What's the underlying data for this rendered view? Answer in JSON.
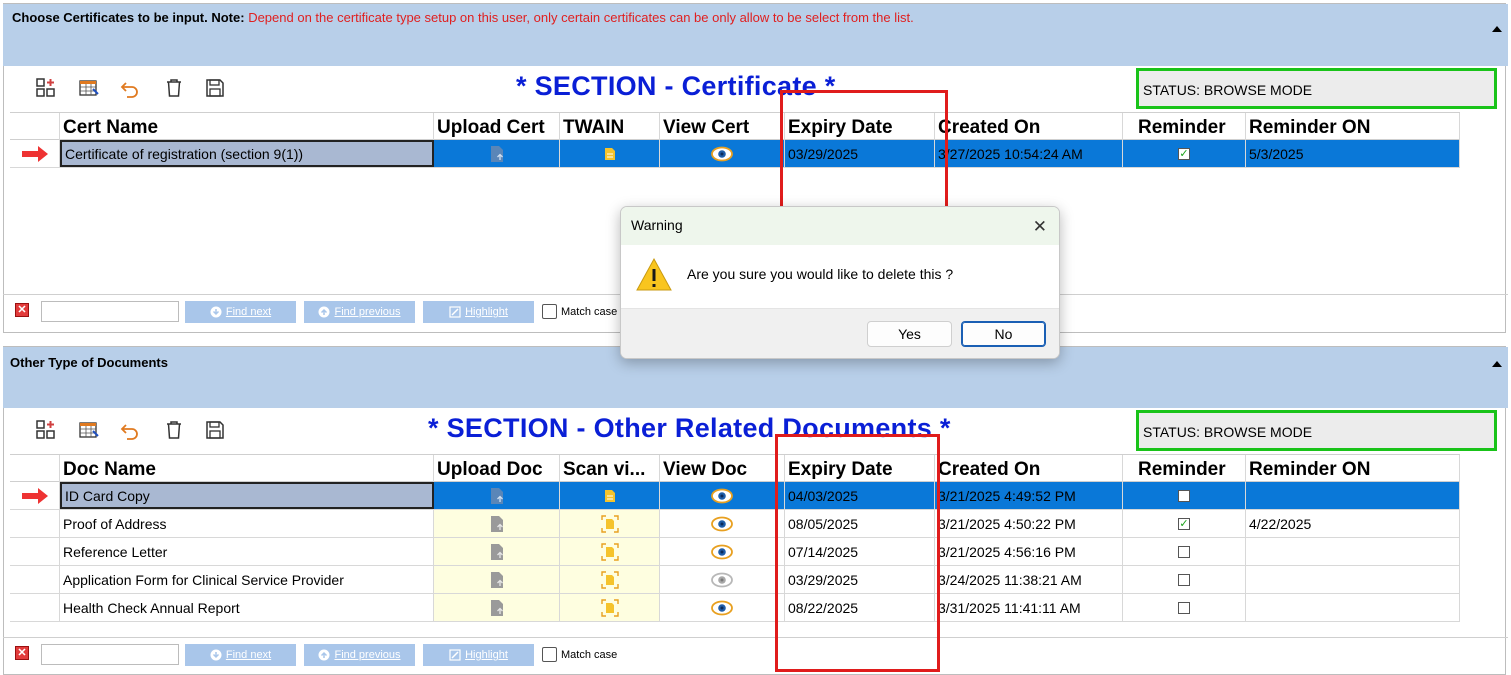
{
  "colors": {
    "header_bg": "#b8cfe9",
    "section_title": "#0a1fd6",
    "status_border": "#19c319",
    "selected_row": "#0a78d8",
    "highlight_box": "#e01c1c",
    "note_text": "#e02020"
  },
  "cert_panel": {
    "header_bold": "Choose Certificates to be input. Note:",
    "header_note": " Depend on the certificate type setup on this user, only certain certificates can be only allow to be select from the list.",
    "section_title": "* SECTION - Certificate *",
    "status": "STATUS:   BROWSE MODE",
    "columns": [
      "Cert Name",
      "Upload Cert",
      "TWAIN",
      "View Cert",
      "Expiry Date",
      "Created On",
      "Reminder",
      "Reminder ON"
    ],
    "rows": [
      {
        "name": "Certificate of registration (section 9(1))",
        "expiry": "03/29/2025",
        "created": "3/27/2025 10:54:24 AM",
        "reminder": true,
        "reminder_on": "5/3/2025"
      }
    ]
  },
  "docs_panel": {
    "header_bold": "Other Type of Documents",
    "section_title": "* SECTION - Other Related Documents *",
    "status": "STATUS:   BROWSE MODE",
    "columns": [
      "Doc Name",
      "Upload Doc",
      "Scan vi...",
      "View Doc",
      "Expiry Date",
      "Created On",
      "Reminder",
      "Reminder ON"
    ],
    "rows": [
      {
        "name": "ID Card Copy",
        "expiry": "04/03/2025",
        "created": "3/21/2025 4:49:52 PM",
        "reminder": false,
        "reminder_on": ""
      },
      {
        "name": "Proof of Address",
        "expiry": "08/05/2025",
        "created": "3/21/2025 4:50:22 PM",
        "reminder": true,
        "reminder_on": "4/22/2025"
      },
      {
        "name": "Reference Letter",
        "expiry": "07/14/2025",
        "created": "3/21/2025 4:56:16 PM",
        "reminder": false,
        "reminder_on": ""
      },
      {
        "name": "Application Form for Clinical Service Provider",
        "expiry": "03/29/2025",
        "created": "3/24/2025 11:38:21 AM",
        "reminder": false,
        "reminder_on": ""
      },
      {
        "name": "Health Check Annual Report",
        "expiry": "08/22/2025",
        "created": "3/31/2025 11:41:11 AM",
        "reminder": false,
        "reminder_on": ""
      }
    ]
  },
  "find_bar": {
    "find_next": "Find next",
    "find_previous": "Find previous",
    "highlight": "Highlight",
    "match_case": "Match case"
  },
  "dialog": {
    "title": "Warning",
    "message": "Are you sure you would like to delete this ?",
    "yes": "Yes",
    "no": "No",
    "close_glyph": "✕"
  }
}
